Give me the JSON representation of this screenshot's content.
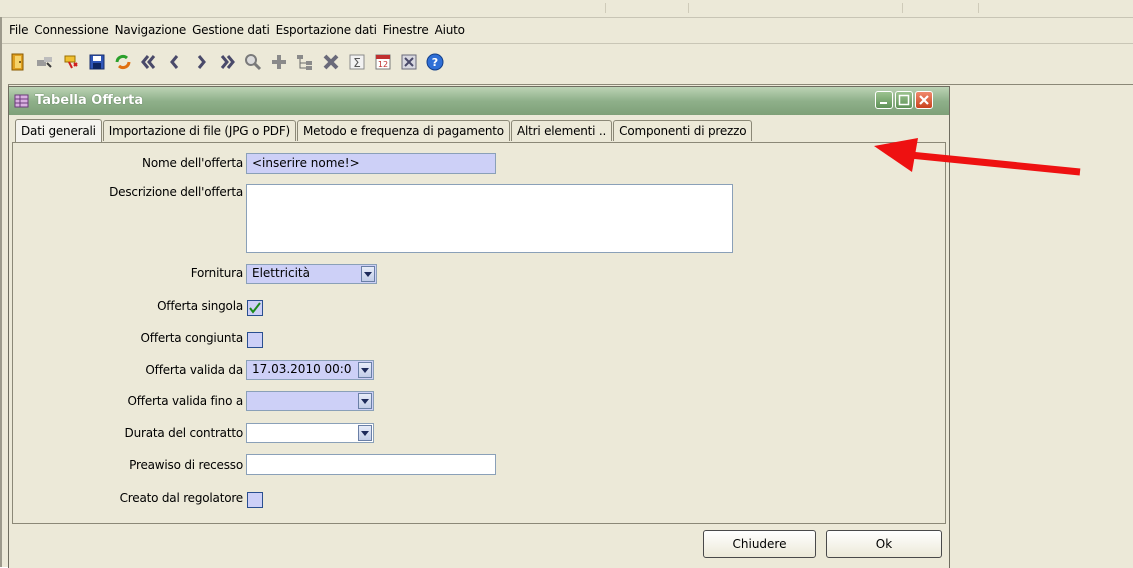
{
  "menu": [
    "File",
    "Connessione",
    "Navigazione",
    "Gestione dati",
    "Esportazione dati",
    "Finestre",
    "Aiuto"
  ],
  "toolbar_icons": [
    "exit-icon",
    "connect-icon",
    "disconnect-icon",
    "save-icon",
    "refresh-icon",
    "first-record-icon",
    "previous-record-icon",
    "next-record-icon",
    "last-record-icon",
    "search-icon",
    "add-icon",
    "tree-icon",
    "delete-icon",
    "sum-icon",
    "calendar-icon",
    "export-excel-icon",
    "help-icon"
  ],
  "window": {
    "title": "Tabella Offerta"
  },
  "tabs": [
    "Dati generali",
    "Importazione di file (JPG o PDF)",
    "Metodo e frequenza di pagamento",
    "Altri elementi ..",
    "Componenti di prezzo"
  ],
  "form": {
    "nome_label": "Nome dell'offerta",
    "nome_value": "<inserire nome!>",
    "descrizione_label": "Descrizione dell'offerta",
    "descrizione_value": "",
    "fornitura_label": "Fornitura",
    "fornitura_value": "Elettricità",
    "singola_label": "Offerta singola",
    "singola_checked": true,
    "congiunta_label": "Offerta congiunta",
    "congiunta_checked": false,
    "valida_da_label": "Offerta valida da",
    "valida_da_value": "17.03.2010 00:0",
    "valida_fino_label": "Offerta valida fino a",
    "valida_fino_value": "",
    "durata_label": "Durata del contratto",
    "durata_value": "",
    "preavviso_label": "Preawiso di recesso",
    "preavviso_value": "",
    "regolatore_label": "Creato dal regolatore",
    "regolatore_checked": false
  },
  "buttons": {
    "close": "Chiudere",
    "ok": "Ok"
  },
  "colors": {
    "titlebar": "#8fb08a",
    "field_bg": "#cdd0f7",
    "arrow": "#ee1111"
  }
}
